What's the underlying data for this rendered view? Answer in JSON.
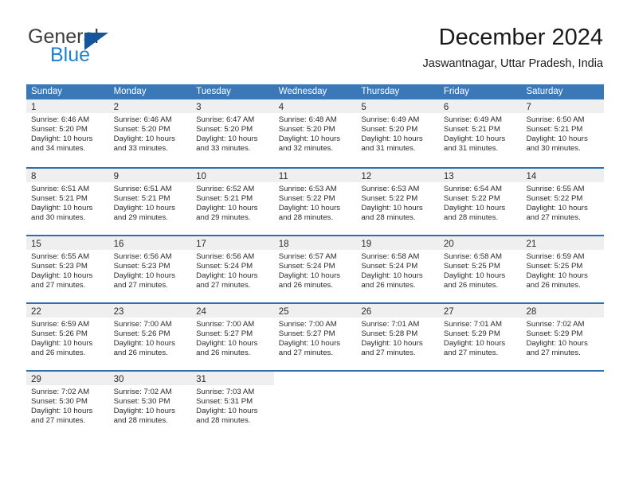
{
  "brand": {
    "name_top": "General",
    "name_bottom": "Blue",
    "triangle_icon": "triangle-logo-icon",
    "accent_color": "#1f7fd0",
    "triangle_color": "#14569e"
  },
  "header": {
    "title": "December 2024",
    "location": "Jaswantnagar, Uttar Pradesh, India"
  },
  "calendar": {
    "header_bg": "#3b78b7",
    "row_divider_color": "#2f6fae",
    "day_band_bg": "#efefef",
    "weekdays": [
      "Sunday",
      "Monday",
      "Tuesday",
      "Wednesday",
      "Thursday",
      "Friday",
      "Saturday"
    ],
    "weeks": [
      [
        {
          "day": "1",
          "lines": [
            "Sunrise: 6:46 AM",
            "Sunset: 5:20 PM",
            "Daylight: 10 hours",
            "and 34 minutes."
          ]
        },
        {
          "day": "2",
          "lines": [
            "Sunrise: 6:46 AM",
            "Sunset: 5:20 PM",
            "Daylight: 10 hours",
            "and 33 minutes."
          ]
        },
        {
          "day": "3",
          "lines": [
            "Sunrise: 6:47 AM",
            "Sunset: 5:20 PM",
            "Daylight: 10 hours",
            "and 33 minutes."
          ]
        },
        {
          "day": "4",
          "lines": [
            "Sunrise: 6:48 AM",
            "Sunset: 5:20 PM",
            "Daylight: 10 hours",
            "and 32 minutes."
          ]
        },
        {
          "day": "5",
          "lines": [
            "Sunrise: 6:49 AM",
            "Sunset: 5:20 PM",
            "Daylight: 10 hours",
            "and 31 minutes."
          ]
        },
        {
          "day": "6",
          "lines": [
            "Sunrise: 6:49 AM",
            "Sunset: 5:21 PM",
            "Daylight: 10 hours",
            "and 31 minutes."
          ]
        },
        {
          "day": "7",
          "lines": [
            "Sunrise: 6:50 AM",
            "Sunset: 5:21 PM",
            "Daylight: 10 hours",
            "and 30 minutes."
          ]
        }
      ],
      [
        {
          "day": "8",
          "lines": [
            "Sunrise: 6:51 AM",
            "Sunset: 5:21 PM",
            "Daylight: 10 hours",
            "and 30 minutes."
          ]
        },
        {
          "day": "9",
          "lines": [
            "Sunrise: 6:51 AM",
            "Sunset: 5:21 PM",
            "Daylight: 10 hours",
            "and 29 minutes."
          ]
        },
        {
          "day": "10",
          "lines": [
            "Sunrise: 6:52 AM",
            "Sunset: 5:21 PM",
            "Daylight: 10 hours",
            "and 29 minutes."
          ]
        },
        {
          "day": "11",
          "lines": [
            "Sunrise: 6:53 AM",
            "Sunset: 5:22 PM",
            "Daylight: 10 hours",
            "and 28 minutes."
          ]
        },
        {
          "day": "12",
          "lines": [
            "Sunrise: 6:53 AM",
            "Sunset: 5:22 PM",
            "Daylight: 10 hours",
            "and 28 minutes."
          ]
        },
        {
          "day": "13",
          "lines": [
            "Sunrise: 6:54 AM",
            "Sunset: 5:22 PM",
            "Daylight: 10 hours",
            "and 28 minutes."
          ]
        },
        {
          "day": "14",
          "lines": [
            "Sunrise: 6:55 AM",
            "Sunset: 5:22 PM",
            "Daylight: 10 hours",
            "and 27 minutes."
          ]
        }
      ],
      [
        {
          "day": "15",
          "lines": [
            "Sunrise: 6:55 AM",
            "Sunset: 5:23 PM",
            "Daylight: 10 hours",
            "and 27 minutes."
          ]
        },
        {
          "day": "16",
          "lines": [
            "Sunrise: 6:56 AM",
            "Sunset: 5:23 PM",
            "Daylight: 10 hours",
            "and 27 minutes."
          ]
        },
        {
          "day": "17",
          "lines": [
            "Sunrise: 6:56 AM",
            "Sunset: 5:24 PM",
            "Daylight: 10 hours",
            "and 27 minutes."
          ]
        },
        {
          "day": "18",
          "lines": [
            "Sunrise: 6:57 AM",
            "Sunset: 5:24 PM",
            "Daylight: 10 hours",
            "and 26 minutes."
          ]
        },
        {
          "day": "19",
          "lines": [
            "Sunrise: 6:58 AM",
            "Sunset: 5:24 PM",
            "Daylight: 10 hours",
            "and 26 minutes."
          ]
        },
        {
          "day": "20",
          "lines": [
            "Sunrise: 6:58 AM",
            "Sunset: 5:25 PM",
            "Daylight: 10 hours",
            "and 26 minutes."
          ]
        },
        {
          "day": "21",
          "lines": [
            "Sunrise: 6:59 AM",
            "Sunset: 5:25 PM",
            "Daylight: 10 hours",
            "and 26 minutes."
          ]
        }
      ],
      [
        {
          "day": "22",
          "lines": [
            "Sunrise: 6:59 AM",
            "Sunset: 5:26 PM",
            "Daylight: 10 hours",
            "and 26 minutes."
          ]
        },
        {
          "day": "23",
          "lines": [
            "Sunrise: 7:00 AM",
            "Sunset: 5:26 PM",
            "Daylight: 10 hours",
            "and 26 minutes."
          ]
        },
        {
          "day": "24",
          "lines": [
            "Sunrise: 7:00 AM",
            "Sunset: 5:27 PM",
            "Daylight: 10 hours",
            "and 26 minutes."
          ]
        },
        {
          "day": "25",
          "lines": [
            "Sunrise: 7:00 AM",
            "Sunset: 5:27 PM",
            "Daylight: 10 hours",
            "and 27 minutes."
          ]
        },
        {
          "day": "26",
          "lines": [
            "Sunrise: 7:01 AM",
            "Sunset: 5:28 PM",
            "Daylight: 10 hours",
            "and 27 minutes."
          ]
        },
        {
          "day": "27",
          "lines": [
            "Sunrise: 7:01 AM",
            "Sunset: 5:29 PM",
            "Daylight: 10 hours",
            "and 27 minutes."
          ]
        },
        {
          "day": "28",
          "lines": [
            "Sunrise: 7:02 AM",
            "Sunset: 5:29 PM",
            "Daylight: 10 hours",
            "and 27 minutes."
          ]
        }
      ],
      [
        {
          "day": "29",
          "lines": [
            "Sunrise: 7:02 AM",
            "Sunset: 5:30 PM",
            "Daylight: 10 hours",
            "and 27 minutes."
          ]
        },
        {
          "day": "30",
          "lines": [
            "Sunrise: 7:02 AM",
            "Sunset: 5:30 PM",
            "Daylight: 10 hours",
            "and 28 minutes."
          ]
        },
        {
          "day": "31",
          "lines": [
            "Sunrise: 7:03 AM",
            "Sunset: 5:31 PM",
            "Daylight: 10 hours",
            "and 28 minutes."
          ]
        },
        {
          "day": "",
          "lines": []
        },
        {
          "day": "",
          "lines": []
        },
        {
          "day": "",
          "lines": []
        },
        {
          "day": "",
          "lines": []
        }
      ]
    ]
  }
}
